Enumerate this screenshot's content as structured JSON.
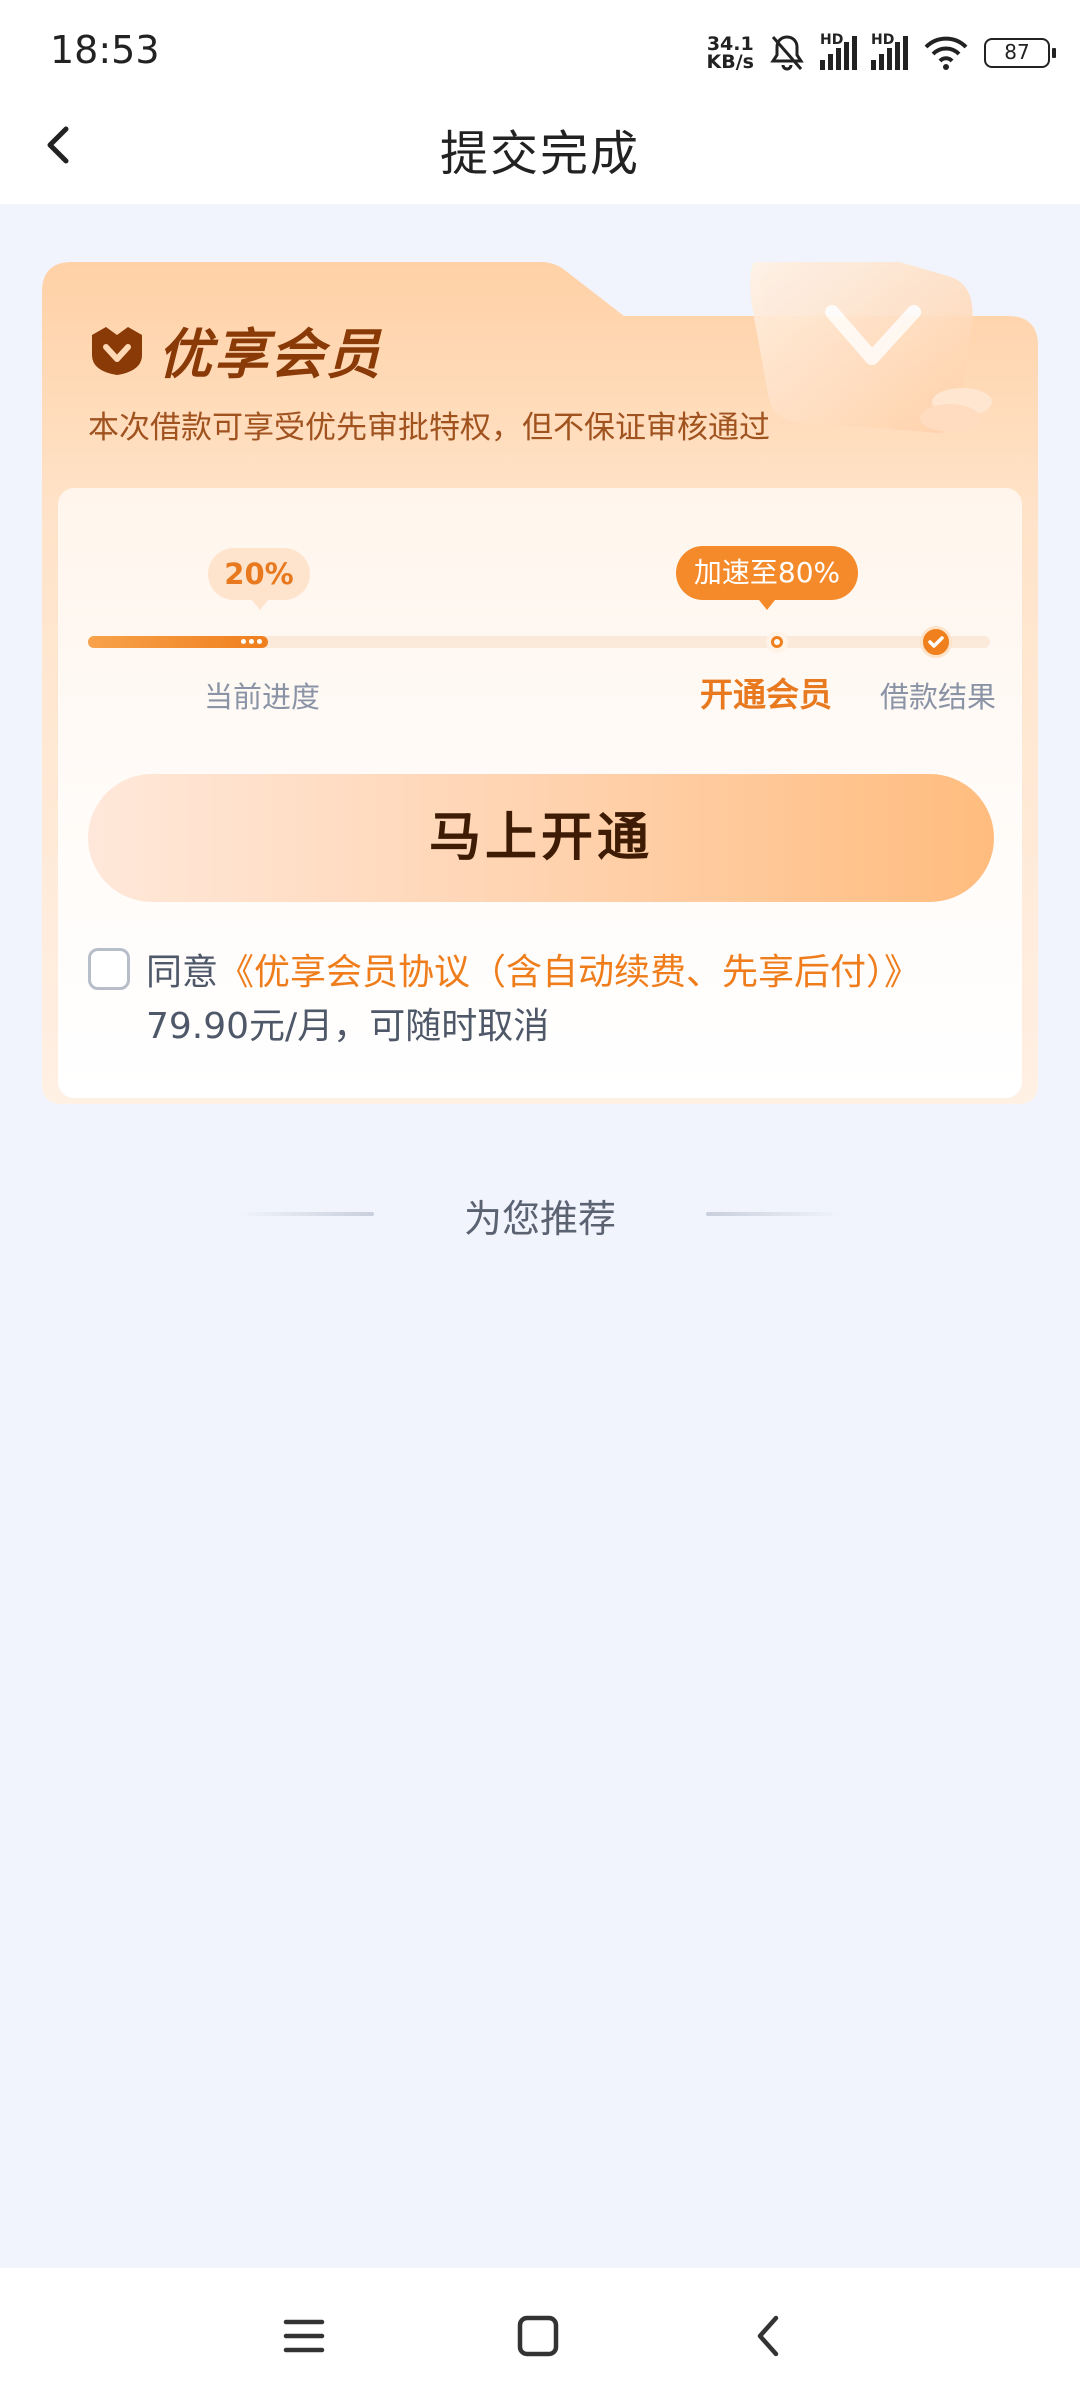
{
  "status_bar": {
    "time": "18:53",
    "net_speed_value": "34.1",
    "net_speed_unit": "KB/s",
    "signal_1_label": "HD",
    "signal_2_label": "HD",
    "battery": "87"
  },
  "header": {
    "title": "提交完成"
  },
  "vip_card": {
    "title": "优享会员",
    "subtitle": "本次借款可享受优先审批特权，但不保证审核通过",
    "current_badge": "20%",
    "current_progress_percent": 20,
    "speedup_badge": "加速至80%",
    "steps": [
      "当前进度",
      "开通会员",
      "借款结果"
    ],
    "open_button_label": "马上开通",
    "agree_prefix": "同意",
    "agree_link": "《优享会员协议（含自动续费、先享后付）》",
    "agree_suffix": "79.90元/月，可随时取消",
    "agree_checked": false
  },
  "recommend": {
    "title": "为您推荐"
  },
  "colors": {
    "accent": "#f07f1e",
    "background": "#f1f4fc",
    "card_title": "#8a3a07"
  }
}
